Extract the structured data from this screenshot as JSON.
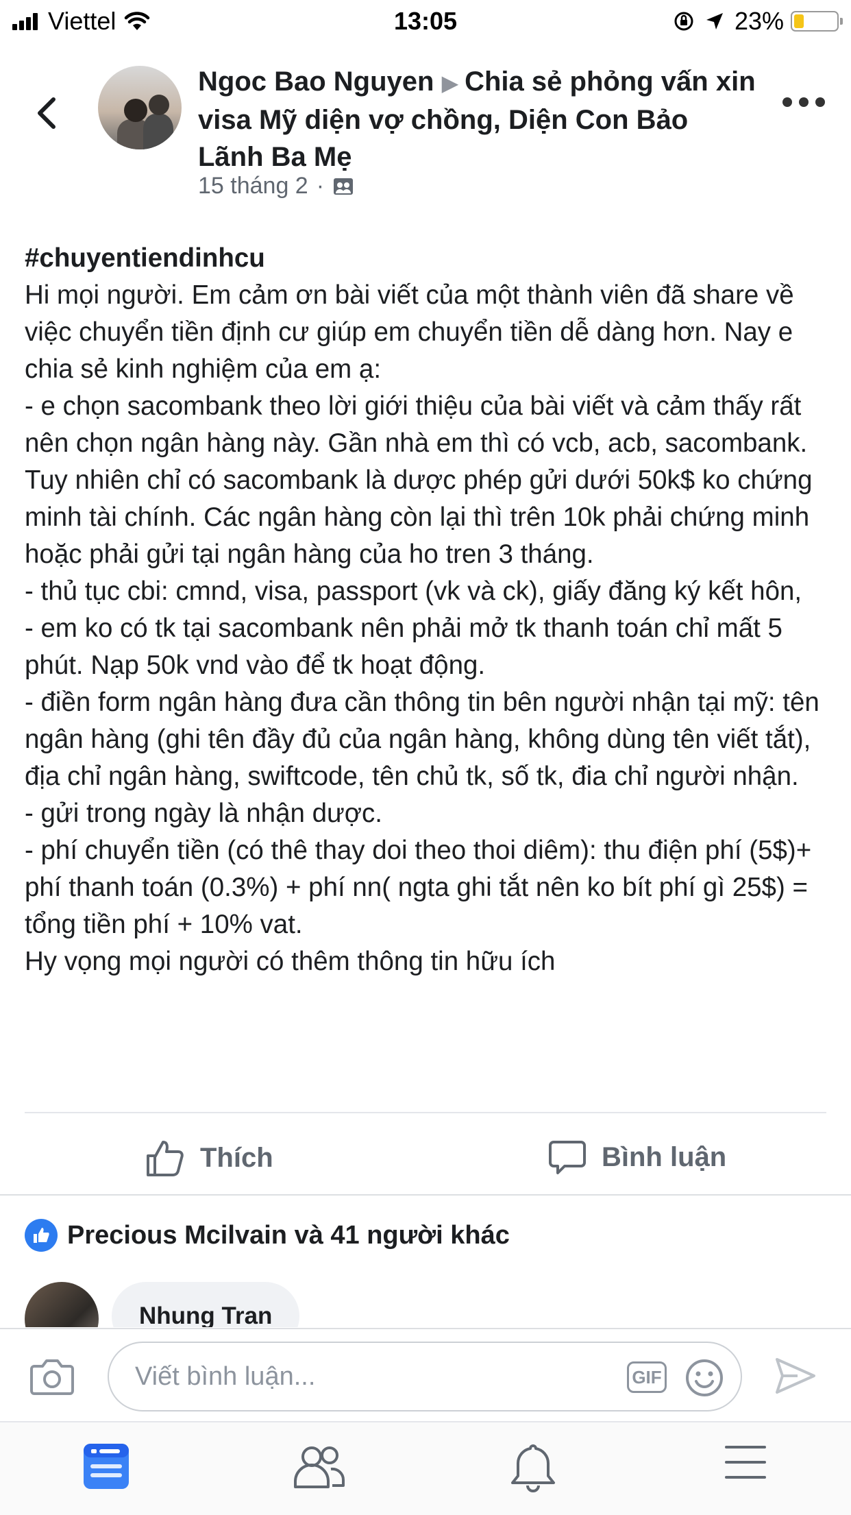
{
  "status_bar": {
    "carrier": "Viettel",
    "time": "13:05",
    "battery_percent_label": "23%",
    "battery_level": 0.23
  },
  "post": {
    "author": "Ngoc Bao Nguyen",
    "group": "Chia sẻ phỏng vấn xin visa Mỹ diện vợ chồng, Diện Con Bảo Lãnh Ba Mẹ",
    "date": "15 tháng 2",
    "hashtag": "#chuyentiendinhcu",
    "paragraphs": [
      "Hi mọi người. Em cảm ơn bài viết của một thành viên đã share về việc chuyển tiền định cư giúp em chuyển tiền dễ dàng hơn. Nay e chia sẻ kinh nghiệm của em ạ:",
      "- e chọn sacombank theo lời giới thiệu của bài viết và cảm thấy rất nên chọn ngân hàng này. Gần nhà em thì có vcb, acb, sacombank. Tuy nhiên chỉ có sacombank là dược phép gửi dưới 50k$ ko chứng minh tài chính. Các ngân hàng còn lại thì trên 10k phải chứng minh hoặc phải gửi tại ngân hàng của ho tren 3 tháng.",
      "- thủ tục cbi: cmnd, visa, passport (vk và ck), giấy đăng ký kết hôn,",
      "- em ko có tk tại sacombank nên phải mở tk thanh toán chỉ mất 5 phút. Nạp 50k vnd vào để tk hoạt động.",
      "- điền form ngân hàng đưa cần thông tin bên người nhận tại mỹ: tên ngân hàng (ghi tên đầy đủ của ngân hàng, không dùng tên viết tắt), địa chỉ ngân hàng, swiftcode, tên chủ tk, số tk, đia chỉ người nhận.",
      "- gửi trong ngày là nhận dược.",
      "- phí chuyển tiền (có thê thay doi theo thoi diêm): thu điện phí (5$)+ phí thanh toán (0.3%) + phí nn( ngta ghi tắt nên ko bít phí gì 25$) = tổng tiền phí + 10% vat.",
      "Hy vọng mọi người có thêm thông tin hữu ích"
    ]
  },
  "actions": {
    "like_label": "Thích",
    "comment_label": "Bình luận"
  },
  "reactions": {
    "summary": "Precious Mcilvain và 41 người khác"
  },
  "comment_preview": {
    "name": "Nhung Tran"
  },
  "composer": {
    "placeholder": "Viết bình luận...",
    "gif_label": "GIF"
  },
  "colors": {
    "accent": "#2d7cf0",
    "muted": "#606770",
    "battery": "#f5c518"
  }
}
